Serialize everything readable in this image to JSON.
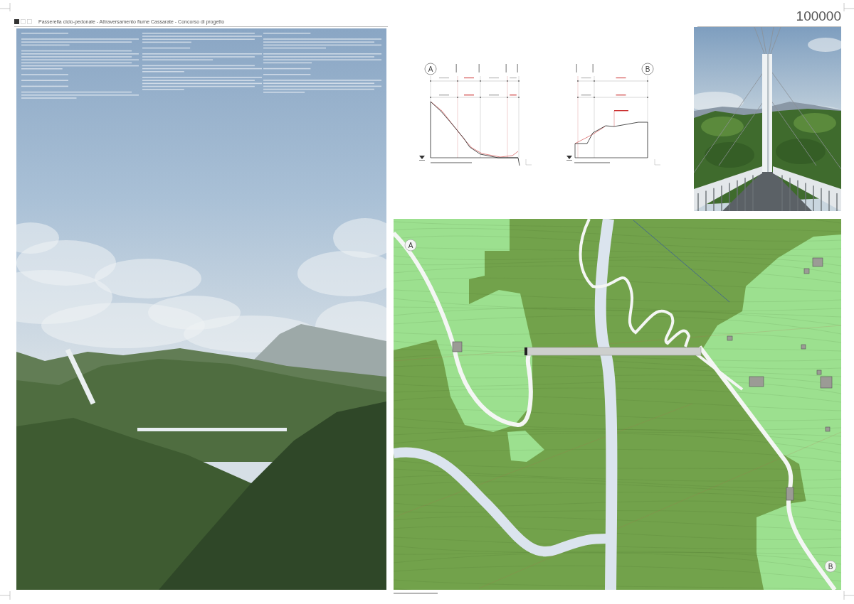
{
  "header": {
    "title": "Passerella ciclo-pedonale - Attraversamento fiume Cassarate - Concorso di progetto",
    "code": "100000"
  },
  "sections": [
    {
      "marker": "A"
    },
    {
      "marker": "B"
    }
  ],
  "site_plan": {
    "markers": [
      {
        "label": "A"
      },
      {
        "label": "B"
      }
    ]
  }
}
